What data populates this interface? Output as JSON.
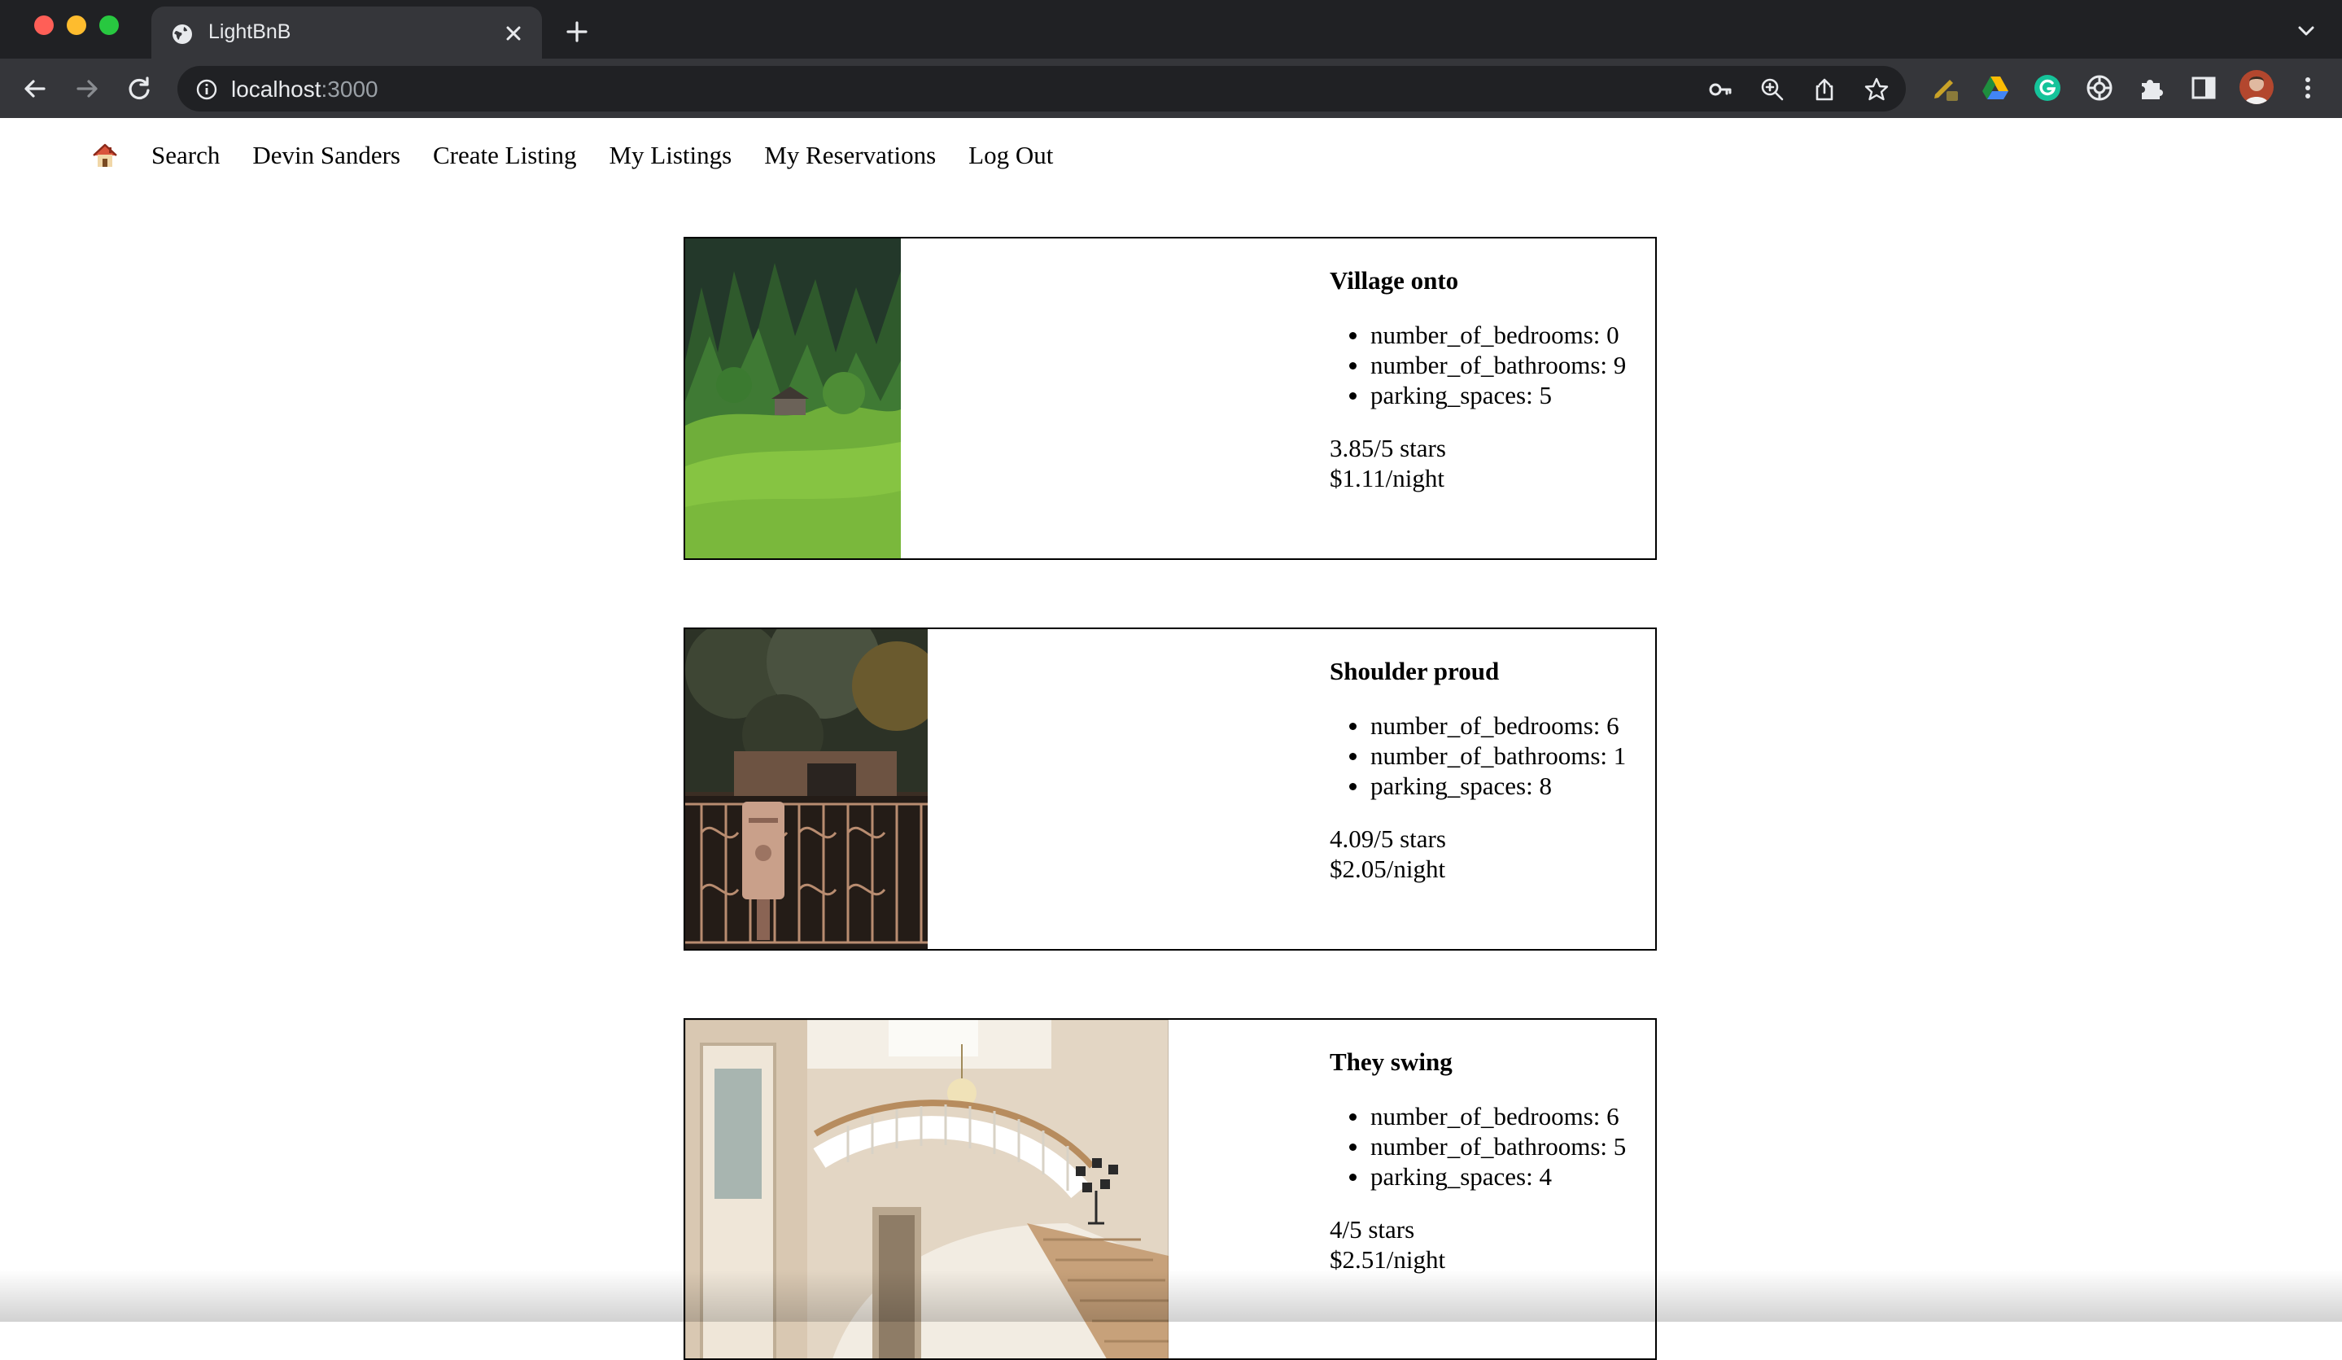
{
  "browser": {
    "tab_title": "LightBnB",
    "url_host": "localhost",
    "url_port": ":3000"
  },
  "nav": {
    "home_icon": "house-icon",
    "items": [
      "Search",
      "Devin Sanders",
      "Create Listing",
      "My Listings",
      "My Reservations",
      "Log Out"
    ]
  },
  "listings": [
    {
      "title": "Village onto",
      "image": "forest-hillside-cabin-photo",
      "details": [
        "number_of_bedrooms: 0",
        "number_of_bathrooms: 9",
        "parking_spaces: 5"
      ],
      "rating": "3.85/5 stars",
      "price": "$1.11/night"
    },
    {
      "title": "Shoulder proud",
      "image": "ornate-gate-mailbox-photo",
      "details": [
        "number_of_bedrooms: 6",
        "number_of_bathrooms: 1",
        "parking_spaces: 8"
      ],
      "rating": "4.09/5 stars",
      "price": "$2.05/night"
    },
    {
      "title": "They swing",
      "image": "spiral-staircase-foyer-photo",
      "details": [
        "number_of_bedrooms: 6",
        "number_of_bathrooms: 5",
        "parking_spaces: 4"
      ],
      "rating": "4/5 stars",
      "price": "$2.51/night"
    }
  ],
  "colors": {
    "chrome_dark": "#202124",
    "chrome_toolbar": "#35363a",
    "text": "#000000"
  }
}
